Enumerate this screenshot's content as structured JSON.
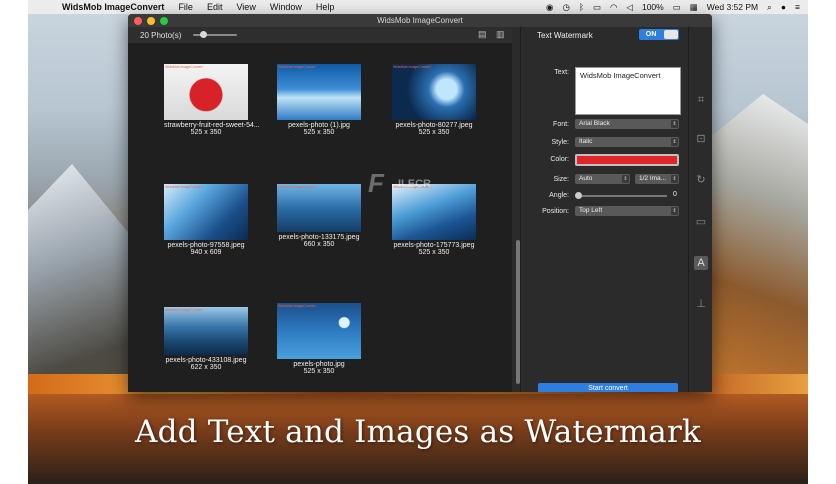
{
  "menubar": {
    "apple_symbol": "",
    "app_name": "WidsMob ImageConvert",
    "menus": [
      "File",
      "Edit",
      "View",
      "Window",
      "Help"
    ],
    "battery": "100%",
    "datetime": "Wed 3:52 PM"
  },
  "window": {
    "title": "WidsMob ImageConvert"
  },
  "toolbar": {
    "photo_count": "20 Photo(s)",
    "zoom_level": 0.15
  },
  "photos": [
    {
      "name": "strawberry-fruit-red-sweet-54...",
      "dim": "525 x 350"
    },
    {
      "name": "pexels-photo (1).jpg",
      "dim": "525 x 350"
    },
    {
      "name": "pexels-photo-80277.jpeg",
      "dim": "525 x 350"
    },
    {
      "name": "pexels-photo-97558.jpeg",
      "dim": "940 x 609"
    },
    {
      "name": "pexels-photo-133175.jpeg",
      "dim": "660 x 350"
    },
    {
      "name": "pexels-photo-175773.jpeg",
      "dim": "525 x 350"
    },
    {
      "name": "pexels-photo-433108.jpeg",
      "dim": "622 x 350"
    },
    {
      "name": "pexels-photo.jpg",
      "dim": "525 x 350"
    }
  ],
  "panel": {
    "title": "Text Watermark",
    "toggle_label": "ON",
    "text_label": "Text:",
    "text_value": "WidsMob ImageConvert",
    "font_label": "Font:",
    "font_value": "Arial Black",
    "style_label": "Style:",
    "style_value": "Italic",
    "color_label": "Color:",
    "color_value": "#e0262a",
    "size_label": "Size:",
    "size_value": "Auto",
    "size_ratio": "1/2 Ima...",
    "angle_label": "Angle:",
    "angle_value": "0",
    "position_label": "Position:",
    "position_value": "Top Left",
    "start_button": "Start convert"
  },
  "strip_icons": [
    "crop-icon",
    "resize-icon",
    "rotate-icon",
    "frame-icon",
    "text-watermark-icon",
    "image-watermark-icon"
  ],
  "overlay": {
    "logo_text": "F",
    "site_text": "ILECR"
  },
  "caption": "Add Text and Images as Watermark"
}
